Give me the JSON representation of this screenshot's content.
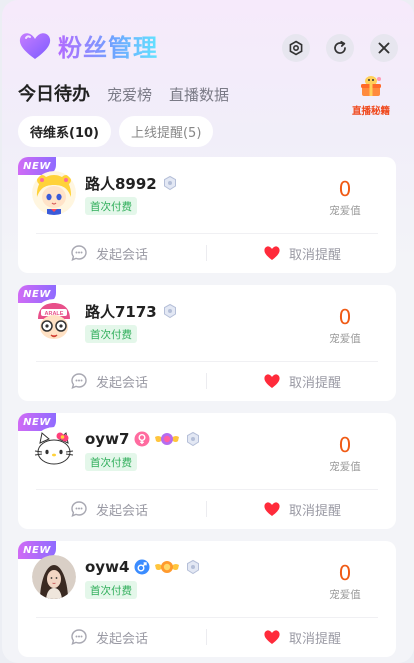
{
  "header": {
    "title": "粉丝管理"
  },
  "tabs": [
    {
      "label": "今日待办",
      "active": true
    },
    {
      "label": "宠爱榜",
      "active": false
    },
    {
      "label": "直播数据",
      "active": false
    }
  ],
  "secret": {
    "label": "直播秘籍"
  },
  "chips": [
    {
      "label": "待维系(10)",
      "active": true
    },
    {
      "label": "上线提醒(5)",
      "active": false
    }
  ],
  "badge_text": "NEW",
  "pay_tag": "首次付费",
  "stat_label": "宠爱值",
  "actions": {
    "chat": "发起会话",
    "cancel": "取消提醒"
  },
  "colors": {
    "accent": "#f05a14",
    "pay_green": "#2fae5a",
    "new_badge": "#b66bfb",
    "heart": "#ff2b3b"
  },
  "fans": [
    {
      "name": "路人8992",
      "value": "0",
      "avatar": "sailor-moon-avatar",
      "badges": [
        "rank-shield-icon"
      ]
    },
    {
      "name": "路人7173",
      "value": "0",
      "avatar": "arale-avatar",
      "badges": [
        "rank-shield-icon"
      ]
    },
    {
      "name": "oyw7",
      "value": "0",
      "avatar": "hello-kitty-avatar",
      "badges": [
        "female-icon",
        "wing-badge-icon",
        "rank-shield-icon"
      ]
    },
    {
      "name": "oyw4",
      "value": "0",
      "avatar": "photo-avatar",
      "badges": [
        "male-icon",
        "wing-badge-icon",
        "rank-shield-icon"
      ]
    }
  ]
}
